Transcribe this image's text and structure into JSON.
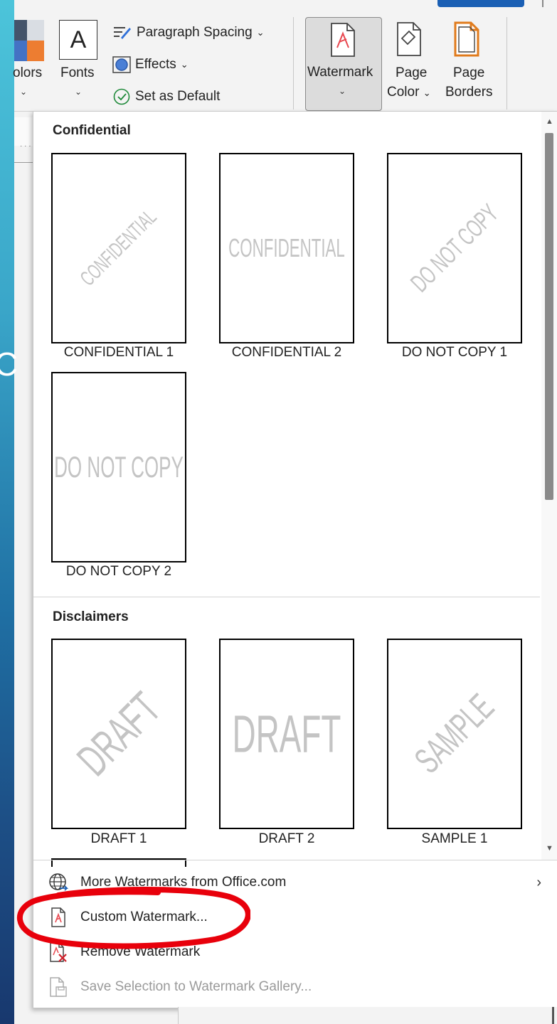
{
  "ribbon": {
    "colors_label": "olors",
    "fonts_icon_letter": "A",
    "fonts_label": "Fonts",
    "paragraph_spacing_label": "Paragraph Spacing",
    "effects_label": "Effects",
    "set_as_default_label": "Set as Default",
    "watermark_label": "Watermark",
    "page_color_label_1": "Page",
    "page_color_label_2": "Color",
    "page_borders_label_1": "Page",
    "page_borders_label_2": "Borders"
  },
  "gallery": {
    "sections": [
      {
        "heading": "Confidential",
        "items": [
          {
            "label": "CONFIDENTIAL 1",
            "watermark_text": "CONFIDENTIAL",
            "style": "diagonal"
          },
          {
            "label": "CONFIDENTIAL 2",
            "watermark_text": "CONFIDENTIAL",
            "style": "horizontal"
          },
          {
            "label": "DO NOT COPY 1",
            "watermark_text": "DO NOT COPY",
            "style": "diagonal"
          },
          {
            "label": "DO NOT COPY 2",
            "watermark_text": "DO NOT COPY",
            "style": "horizontal"
          }
        ]
      },
      {
        "heading": "Disclaimers",
        "items": [
          {
            "label": "DRAFT 1",
            "watermark_text": "DRAFT",
            "style": "diagonal"
          },
          {
            "label": "DRAFT 2",
            "watermark_text": "DRAFT",
            "style": "horizontal"
          },
          {
            "label": "SAMPLE 1",
            "watermark_text": "SAMPLE",
            "style": "diagonal"
          }
        ]
      }
    ]
  },
  "menu": {
    "more_watermarks": "More Watermarks from Office.com",
    "custom_watermark": "Custom Watermark...",
    "remove_watermark": "Remove Watermark",
    "save_selection": "Save Selection to Watermark Gallery..."
  },
  "colors": {
    "annotation_red": "#e8000b",
    "accent_blue": "#1a5fb4",
    "watermark_icon_red": "#e8474f",
    "page_borders_orange": "#e07b1d"
  },
  "icons": {
    "globe": "globe-icon",
    "custom": "custom-watermark-icon",
    "remove": "remove-watermark-icon",
    "save": "save-to-gallery-icon"
  }
}
